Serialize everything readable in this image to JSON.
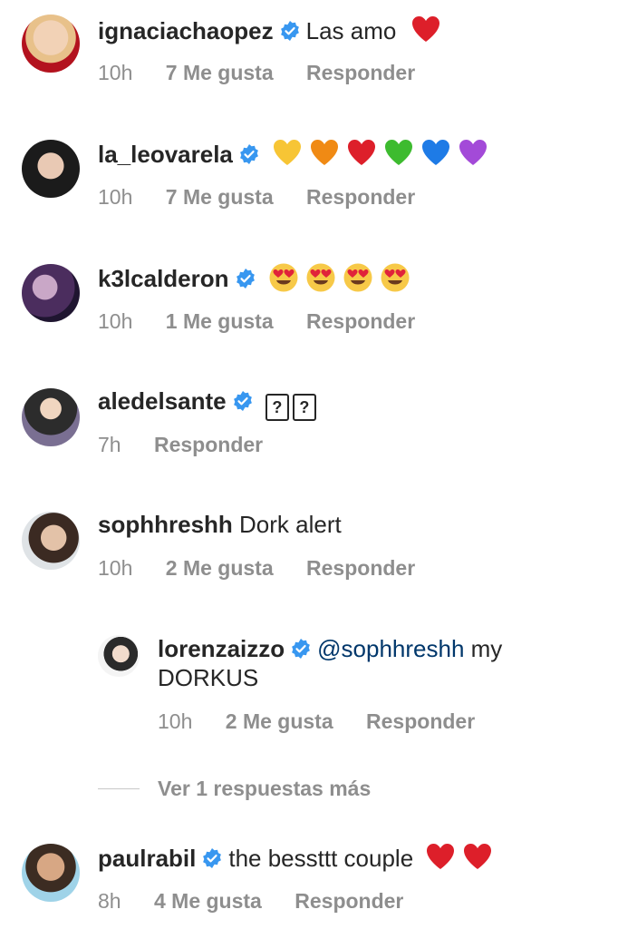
{
  "comments": [
    {
      "user": "ignaciachaopez",
      "text": "Las amo",
      "emoji": [
        "red-heart"
      ],
      "time": "10h",
      "likes": "7 Me gusta",
      "reply": "Responder"
    },
    {
      "user": "la_leovarela",
      "text": "",
      "emoji": [
        "yellow-heart",
        "orange-heart",
        "red-heart",
        "green-heart",
        "blue-heart",
        "purple-heart"
      ],
      "time": "10h",
      "likes": "7 Me gusta",
      "reply": "Responder"
    },
    {
      "user": "k3lcalderon",
      "text": "",
      "emoji": [
        "heart-eyes",
        "heart-eyes",
        "heart-eyes",
        "heart-eyes"
      ],
      "time": "10h",
      "likes": "1 Me gusta",
      "reply": "Responder"
    },
    {
      "user": "aledelsante",
      "text": "",
      "boxes": [
        "?",
        "?"
      ],
      "time": "7h",
      "reply": "Responder"
    },
    {
      "user": "sophhreshh",
      "text": "Dork alert",
      "time": "10h",
      "likes": "2 Me gusta",
      "reply": "Responder"
    },
    {
      "user": "lorenzaizzo",
      "mention": "@sophhreshh",
      "text": " my",
      "text2": "DORKUS",
      "time": "10h",
      "likes": "2 Me gusta",
      "reply": "Responder"
    },
    {
      "user": "paulrabil",
      "text": "the bessttt couple",
      "emoji": [
        "red-heart",
        "red-heart"
      ],
      "time": "8h",
      "likes": "4 Me gusta",
      "reply": "Responder"
    }
  ],
  "more_replies": "Ver 1 respuestas más",
  "colors": {
    "verified": "#3897f0",
    "meta": "#8e8e8e",
    "mention": "#00376b"
  }
}
